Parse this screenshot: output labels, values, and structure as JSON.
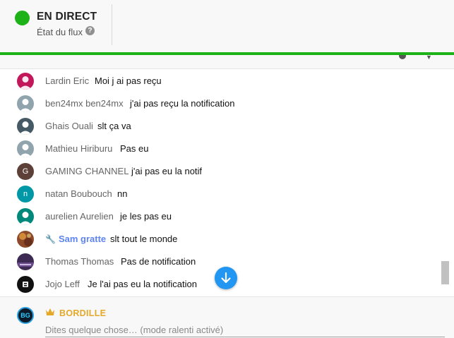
{
  "header": {
    "status": "EN DIRECT",
    "flux_label": "État du flux",
    "help_glyph": "?"
  },
  "messages": [
    {
      "author": "Lardin Eric",
      "text": "Moi j ai pas reçu",
      "avatar_color": "#c2185b"
    },
    {
      "author": "ben24mx ben24mx",
      "text": "j'ai pas reçu la notification",
      "avatar_color": "#90a4ae"
    },
    {
      "author": "Ghais Ouali",
      "text": "slt ça va",
      "avatar_color": "#455a64"
    },
    {
      "author": "Mathieu Hiriburu",
      "text": "Pas eu",
      "avatar_color": "#90a4ae"
    },
    {
      "author": "GAMING CHANNEL",
      "text": "j'ai pas eu la notif",
      "avatar_color": "#5d4037",
      "avatar_letter": "G"
    },
    {
      "author": "natan Boubouch",
      "text": "nn",
      "avatar_color": "#0097a7",
      "avatar_letter": "n"
    },
    {
      "author": "aurelien Aurelien",
      "text": "je les pas eu",
      "avatar_color": "#00897b"
    },
    {
      "author": "Sam gratte",
      "text": "slt tout le monde",
      "avatar_color": "#8d4a2a",
      "role": "moderator"
    },
    {
      "author": "Thomas Thomas",
      "text": "Pas de notification",
      "avatar_color": "#3d2a52"
    },
    {
      "author": "Jojo Leff",
      "text": "Je l'ai pas eu la notification",
      "avatar_color": "#111111"
    }
  ],
  "footer": {
    "user_name": "BORDILLE",
    "avatar_letters": "BG",
    "input_placeholder": "Dites quelque chose… (mode ralenti activé)"
  },
  "colors": {
    "live_green": "#1db318",
    "moderator_blue": "#5e84f1",
    "owner_gold": "#e5a92a",
    "scroll_button": "#2196f3"
  }
}
